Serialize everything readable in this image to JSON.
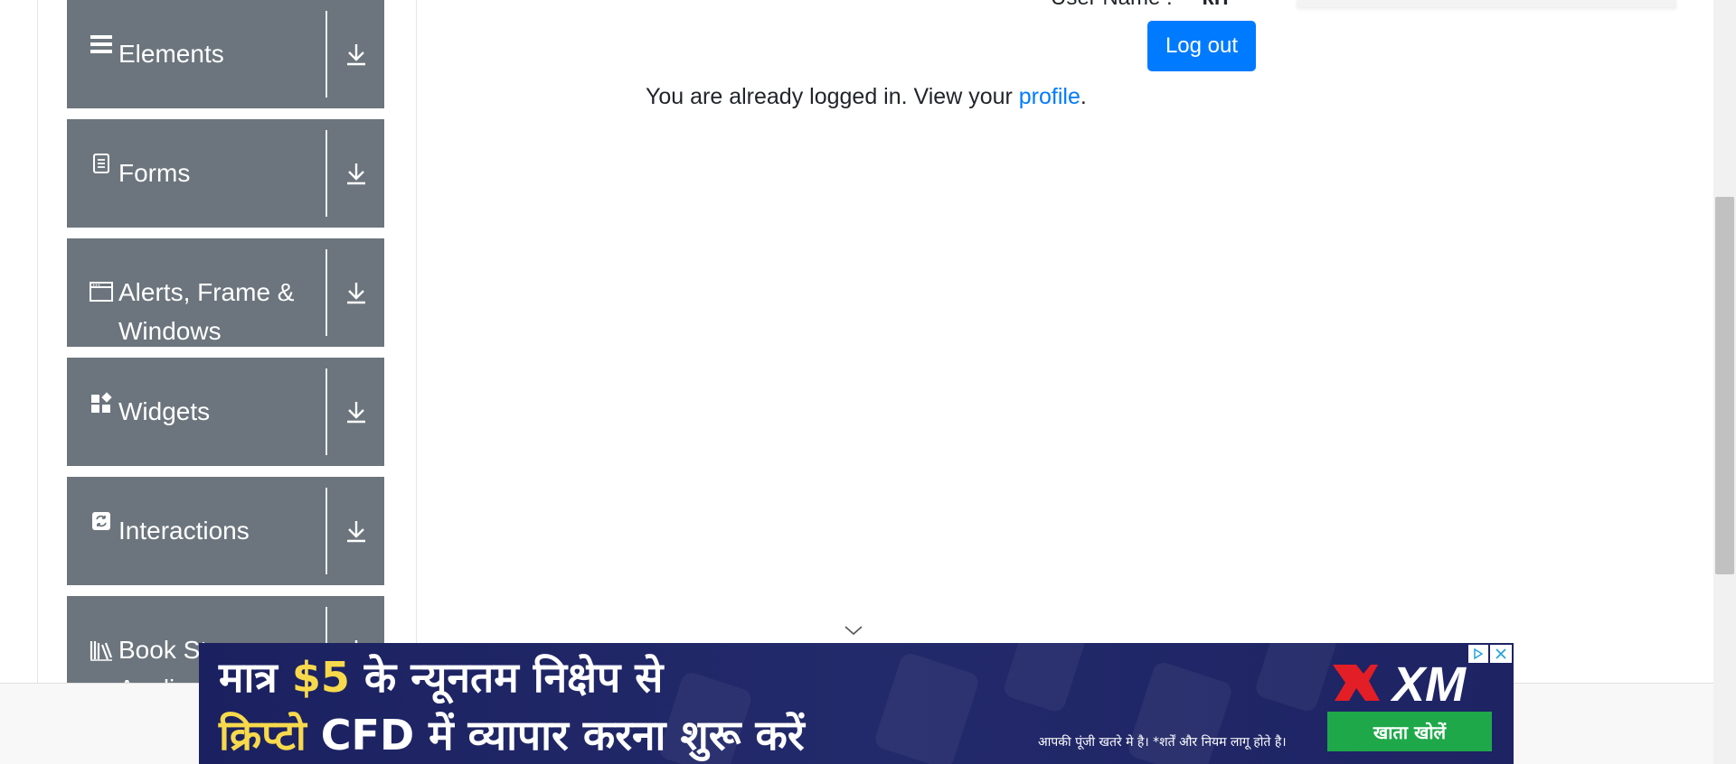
{
  "sidebar": {
    "groups": [
      {
        "label": "Elements",
        "icon": "hamburger-icon"
      },
      {
        "label": "Forms",
        "icon": "document-icon"
      },
      {
        "label": "Alerts, Frame & Windows",
        "icon": "window-icon"
      },
      {
        "label": "Widgets",
        "icon": "widgets-icon"
      },
      {
        "label": "Interactions",
        "icon": "interactions-icon"
      },
      {
        "label": "Book Store Application",
        "icon": "books-icon"
      }
    ]
  },
  "main": {
    "user_name_label": "User Name :",
    "user_name_value": "kri",
    "logout_label": "Log out",
    "logged_in_text": "You are already logged in. View your ",
    "profile_link": "profile",
    "logged_in_suffix": "."
  },
  "ad": {
    "line1_prefix": "मात्र ",
    "line1_amount": "$5",
    "line1_suffix": " के न्यूनतम निक्षेप से",
    "line2_highlight": "क्रिप्टो",
    "line2_suffix": " CFD में  व्यापार करना शुरू करें",
    "brand": "XM",
    "risk_text": "आपकी पूंजी खतरे मे है। *शर्तें और नियम लागू होते है।",
    "cta_label": "खाता खोलें"
  },
  "colors": {
    "sidebar_bg": "#6c757d",
    "primary": "#007bff",
    "ad_bg": "#1b2160",
    "ad_cta": "#1fa84a",
    "ad_highlight": "#f7d94c",
    "brand_red": "#e41e26"
  }
}
